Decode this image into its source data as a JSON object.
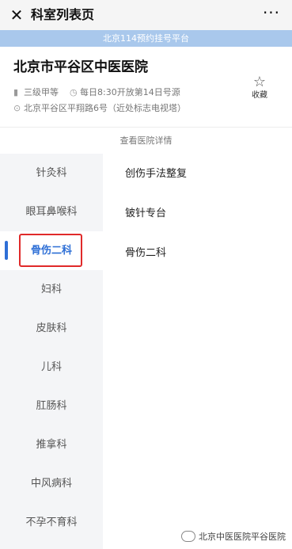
{
  "titlebar": {
    "title": "科室列表页",
    "close_glyph": "✕",
    "more_glyph": "···"
  },
  "banner": {
    "text": "北京114预约挂号平台"
  },
  "hospital": {
    "name": "北京市平谷区中医医院",
    "level": "三级甲等",
    "schedule": "每日8:30开放第14日号源",
    "address": "北京平谷区平翔路6号（近处标志电视塔）",
    "favorite_label": "收藏"
  },
  "detail_link": "查看医院详情",
  "departments": [
    {
      "label": "针灸科"
    },
    {
      "label": "眼耳鼻喉科"
    },
    {
      "label": "骨伤二科"
    },
    {
      "label": "妇科"
    },
    {
      "label": "皮肤科"
    },
    {
      "label": "儿科"
    },
    {
      "label": "肛肠科"
    },
    {
      "label": "推拿科"
    },
    {
      "label": "中风病科"
    },
    {
      "label": "不孕不育科"
    }
  ],
  "selected_department_index": 2,
  "sub_departments": [
    {
      "label": "创伤手法整复"
    },
    {
      "label": "铍针专台"
    },
    {
      "label": "骨伤二科"
    }
  ],
  "watermark": {
    "text": "北京中医医院平谷医院"
  },
  "colors": {
    "accent": "#2e6fd6",
    "banner": "#a9c8ec",
    "highlight_box": "#e02a2a"
  }
}
